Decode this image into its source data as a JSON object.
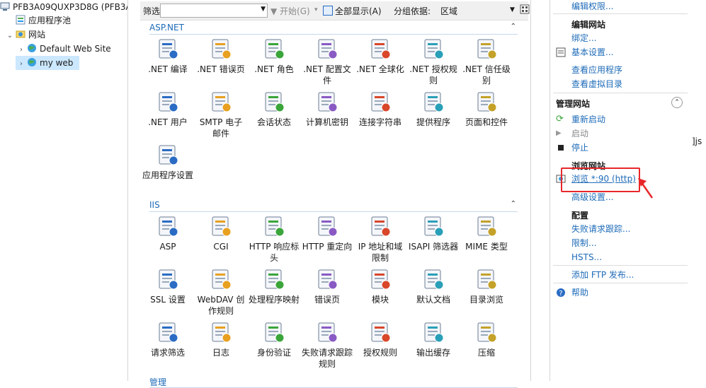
{
  "tree": {
    "server": "PFB3A09QUXP3D8G (PFB3A",
    "app_pools": "应用程序池",
    "sites": "网站",
    "site1": "Default Web Site",
    "site2": "my web"
  },
  "filterbar": {
    "filter_label": "筛选:",
    "start": "开始(G)",
    "show_all": "全部显示(A)",
    "group_by_label": "分组依据:",
    "group_by_value": "区域"
  },
  "sections": [
    {
      "title": "ASP.NET"
    },
    {
      "title": "IIS"
    },
    {
      "title": "管理"
    }
  ],
  "aspnet": [
    ".NET 编译",
    ".NET 错误页",
    ".NET 角色",
    ".NET 配置文件",
    ".NET 全球化",
    ".NET 授权规则",
    ".NET 信任级别",
    ".NET 用户",
    "SMTP 电子邮件",
    "会话状态",
    "计算机密钥",
    "连接字符串",
    "提供程序",
    "页面和控件",
    "应用程序设置"
  ],
  "iis": [
    "ASP",
    "CGI",
    "HTTP 响应标头",
    "HTTP 重定向",
    "IP 地址和域限制",
    "ISAPI 筛选器",
    "MIME 类型",
    "SSL 设置",
    "WebDAV 创作规则",
    "处理程序映射",
    "错误页",
    "模块",
    "默认文档",
    "目录浏览",
    "请求筛选",
    "日志",
    "身份验证",
    "失败请求跟踪规则",
    "授权规则",
    "输出缓存",
    "压缩"
  ],
  "actions": {
    "edit_permissions": "编辑权限...",
    "edit_site_header": "编辑网站",
    "bindings": "绑定...",
    "basic_settings": "基本设置...",
    "view_apps": "查看应用程序",
    "view_vdirs": "查看虚拟目录",
    "manage_site_header": "管理网站",
    "restart": "重新启动",
    "start": "启动",
    "stop": "停止",
    "browse_header": "浏览网站",
    "browse_link": "浏览 *:90 (http)",
    "advanced": "高级设置...",
    "config_header": "配置",
    "failed_req": "失败请求跟踪...",
    "limits": "限制...",
    "hsts": "HSTS...",
    "add_ftp": "添加 FTP 发布...",
    "help": "帮助"
  },
  "far_right_text": "]js",
  "colors": {
    "accent": "#1e6bb8",
    "highlight": "#e8272a",
    "selection": "#cce8ff"
  }
}
